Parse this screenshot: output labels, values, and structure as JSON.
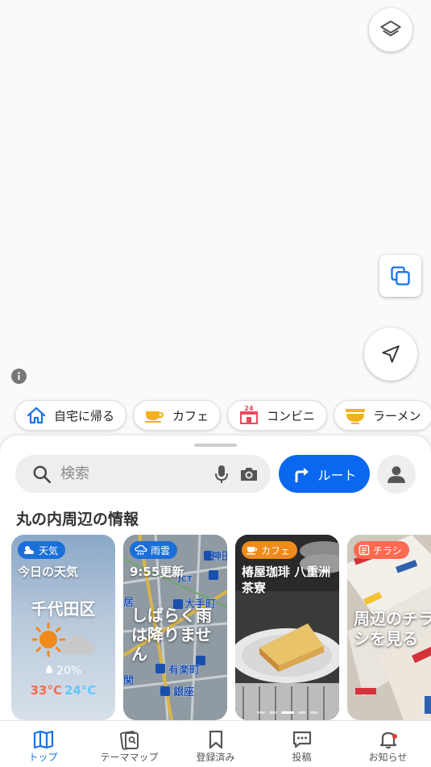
{
  "chips": [
    {
      "label": "自宅に帰る",
      "icon": "home-icon"
    },
    {
      "label": "カフェ",
      "icon": "cafe-cup-icon"
    },
    {
      "label": "コンビニ",
      "icon": "convenience-store-24-icon"
    },
    {
      "label": "ラーメン",
      "icon": "ramen-bowl-icon"
    }
  ],
  "convenience_badge": "24",
  "search": {
    "placeholder": "検索"
  },
  "route_button": {
    "label": "ルート"
  },
  "section_title": "丸の内周辺の情報",
  "cards": {
    "weather": {
      "tag": "天気",
      "title": "今日の天気",
      "city": "千代田区",
      "rain_chance": "20%",
      "high": "33°C",
      "low": "24°C"
    },
    "rain": {
      "tag": "雨雲",
      "title": "9:55更新",
      "message": "しばらく雨は降りません",
      "map_labels": [
        "神田",
        "JCT",
        "大手町",
        "居",
        "有楽町",
        "銀座",
        "関"
      ]
    },
    "cafe": {
      "tag": "カフェ",
      "title": "椿屋珈琲 八重洲茶寮"
    },
    "flyer": {
      "tag": "チラシ",
      "message": "周辺のチラシを見る"
    }
  },
  "tabbar": [
    {
      "label": "トップ",
      "icon": "map-book-icon",
      "active": true
    },
    {
      "label": "テーママップ",
      "icon": "theme-map-icon",
      "active": false
    },
    {
      "label": "登録済み",
      "icon": "bookmark-icon",
      "active": false
    },
    {
      "label": "投稿",
      "icon": "comment-icon",
      "active": false
    },
    {
      "label": "お知らせ",
      "icon": "bell-icon",
      "active": false
    }
  ],
  "colors": {
    "accent": "#0a67f0",
    "tab_active": "#1a73e8",
    "high_temp": "#ff6a4d",
    "low_temp": "#5ec8ff",
    "cafe_tag": "#f08a1a",
    "flyer_tag": "#ff6a50"
  }
}
